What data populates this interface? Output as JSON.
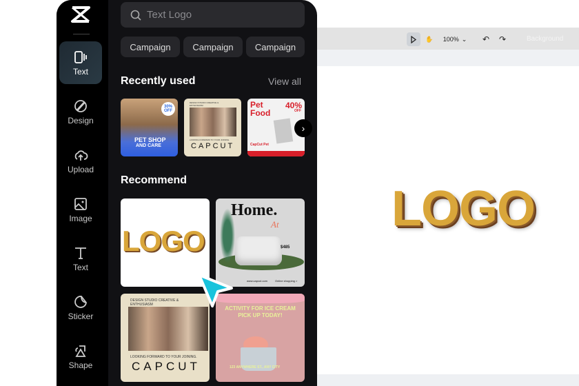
{
  "toolbar": {
    "zoom": "100%",
    "background_label": "Background",
    "icons": [
      "pointer-icon",
      "hand-icon",
      "undo-icon",
      "redo-icon"
    ]
  },
  "canvas": {
    "logo_text": "LOGO"
  },
  "rail": {
    "items": [
      {
        "label": "Text",
        "icon": "text-template-icon",
        "active": true
      },
      {
        "label": "Design",
        "icon": "design-brush-icon"
      },
      {
        "label": "Upload",
        "icon": "cloud-upload-icon"
      },
      {
        "label": "Image",
        "icon": "image-icon"
      },
      {
        "label": "Text",
        "icon": "text-t-icon"
      },
      {
        "label": "Sticker",
        "icon": "sticker-icon"
      },
      {
        "label": "Shape",
        "icon": "shape-icon"
      }
    ]
  },
  "panel": {
    "search_placeholder": "Text Logo",
    "chips": [
      "Campaign",
      "Campaign",
      "Campaign"
    ],
    "recent_title": "Recently used",
    "view_all": "View all",
    "recent": [
      {
        "title": "PET SHOP",
        "subtitle": "AND CARE",
        "badge": "30% OFF"
      },
      {
        "heading": "DESIGN STUDIO CREATIVE & ENTHUSIASM",
        "tagline": "LOOKING FORWARD TO YOUR JOINING.",
        "brand": "CAPCUT"
      },
      {
        "title": "Pet Food",
        "badge": "40%",
        "badge_sub": "OFF",
        "footer": "CapCut Pet"
      }
    ],
    "recommend_title": "Recommend",
    "recommend": [
      {
        "text": "LOGO"
      },
      {
        "title": "Home.",
        "script": "At",
        "price": "$485",
        "footer": [
          "www.capcut.com",
          "Online shopping >"
        ]
      },
      {
        "heading": "DESIGN STUDIO CREATIVE & ENTHUSIASM",
        "tagline": "LOOKING FORWARD TO YOUR JOINING.",
        "brand": "CAPCUT"
      },
      {
        "title": "ACTIVITY FOR ICE CREAM PICK UP TODAY!",
        "footer": "123 ANYWHERE ST., ANY CITY"
      }
    ]
  },
  "colors": {
    "accent_cursor": "#19c3dc",
    "gold": "#d9a63a",
    "panel": "#111114"
  }
}
